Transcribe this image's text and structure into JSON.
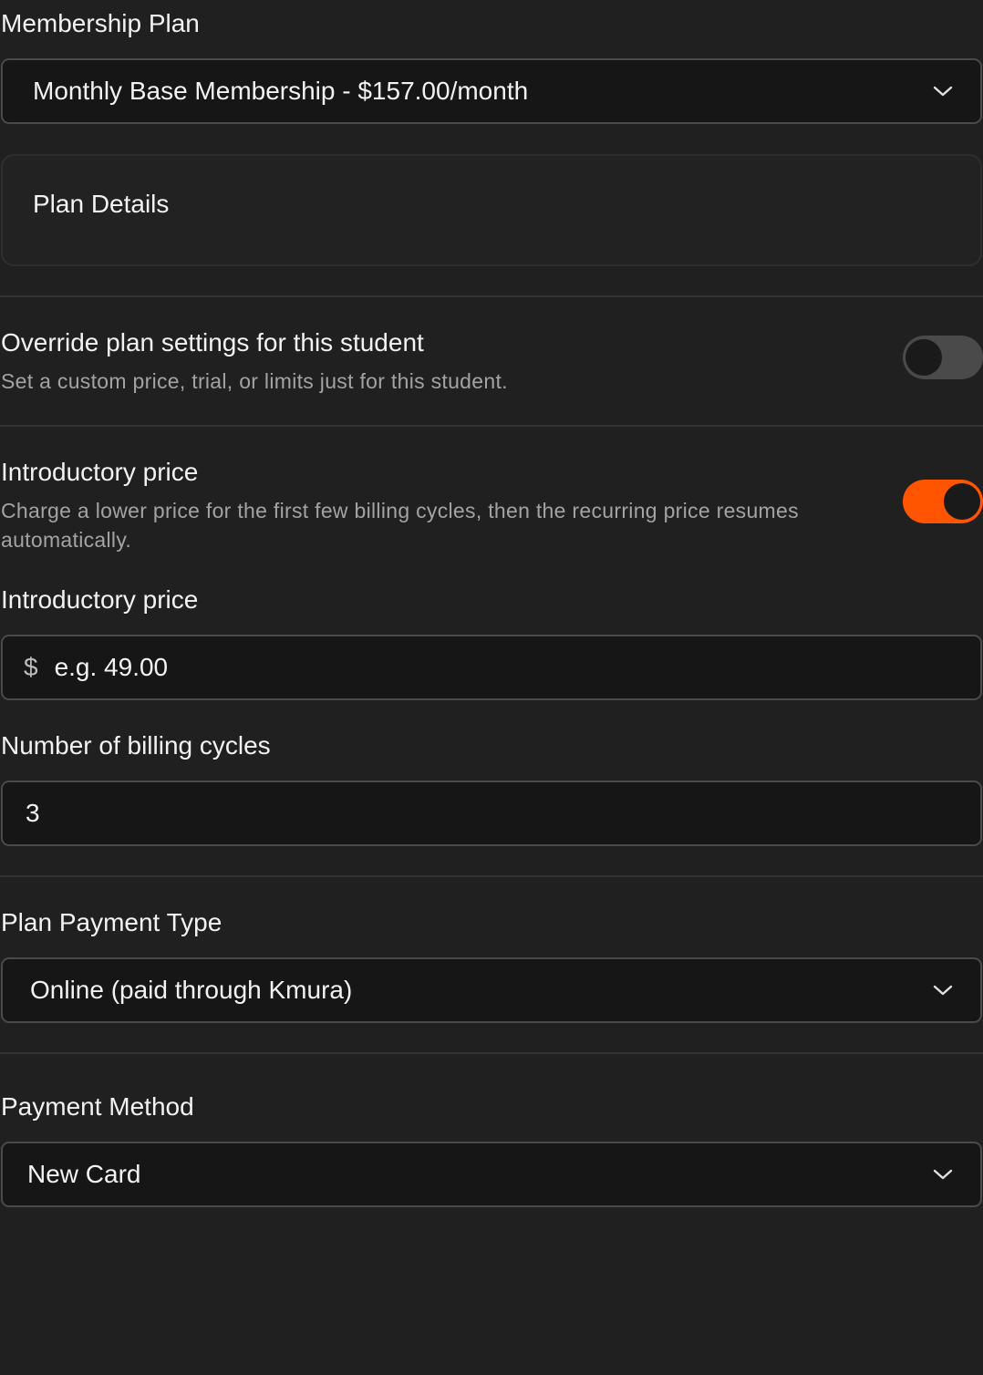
{
  "membership_plan": {
    "label": "Membership Plan",
    "selected": "Monthly Base Membership - $157.00/month"
  },
  "plan_details": {
    "title": "Plan Details"
  },
  "override": {
    "title": "Override plan settings for this student",
    "description": "Set a custom price, trial, or limits just for this student.",
    "enabled": false
  },
  "intro_toggle": {
    "title": "Introductory price",
    "description_line1": "Charge a lower price for the first few billing cycles, then the recurring price resumes",
    "description_line2": "automatically.",
    "enabled": true
  },
  "intro_price": {
    "label": "Introductory price",
    "prefix": "$",
    "placeholder": "e.g. 49.00"
  },
  "billing_cycles": {
    "label": "Number of billing cycles",
    "value": "3"
  },
  "payment_type": {
    "label": "Plan Payment Type",
    "selected": "Online (paid through Kmura)"
  },
  "payment_method": {
    "label": "Payment Method",
    "selected": "New Card"
  },
  "colors": {
    "background": "#202020",
    "field_background": "#161616",
    "accent": "#ff5500",
    "muted_text": "#a3a3a3"
  }
}
